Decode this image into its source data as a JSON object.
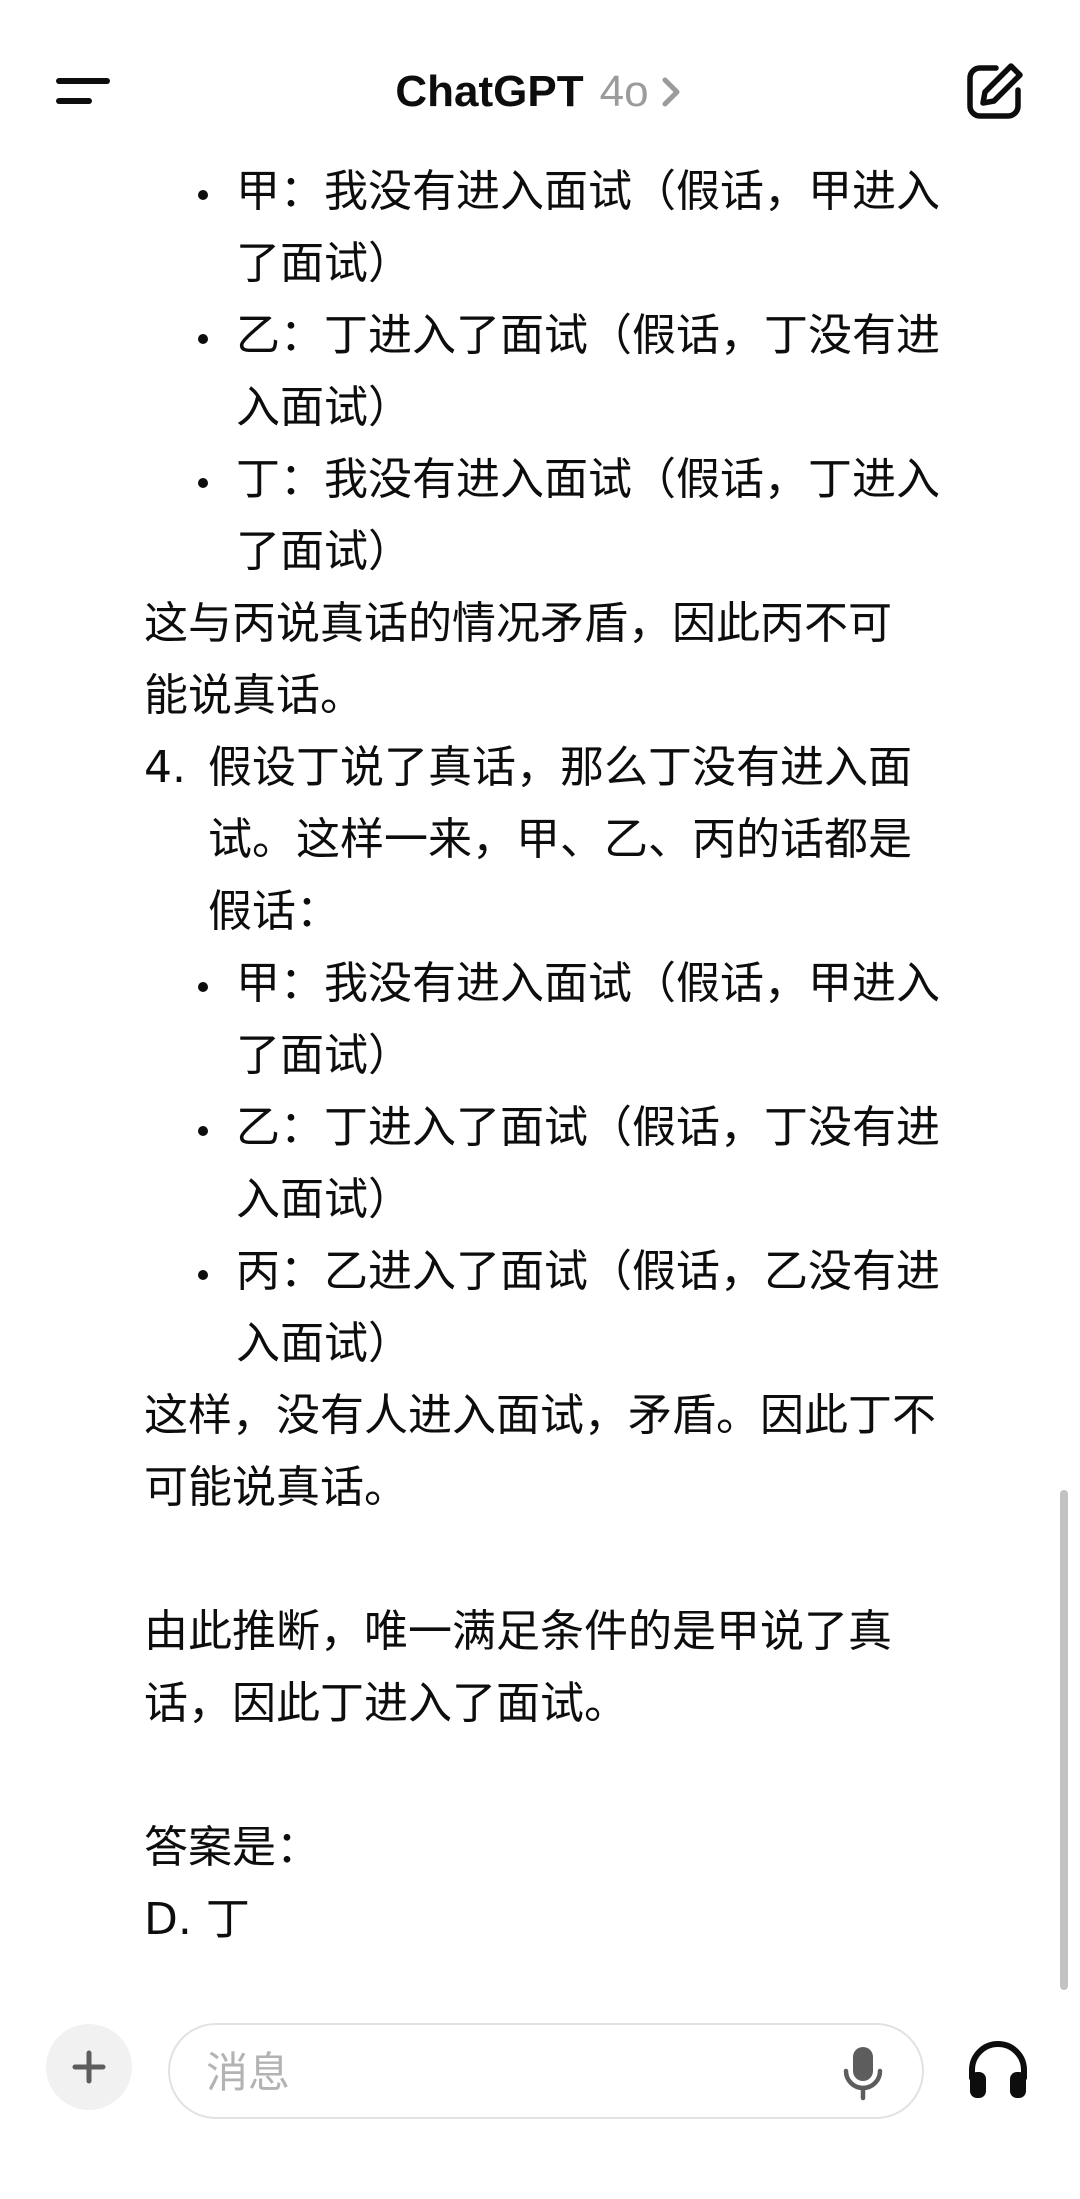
{
  "header": {
    "title": "ChatGPT",
    "model": "4o"
  },
  "message": {
    "lines": [
      "甲：我没有进入面试（假话，甲进入",
      "了面试）",
      "乙：丁进入了面试（假话，丁没有进",
      "入面试）",
      "丁：我没有进入面试（假话，丁进入",
      "了面试）",
      "这与丙说真话的情况矛盾，因此丙不可",
      "能说真话。",
      "4.",
      "假设丁说了真话，那么丁没有进入面",
      "试。这样一来，甲、乙、丙的话都是",
      "假话：",
      "甲：我没有进入面试（假话，甲进入",
      "了面试）",
      "乙：丁进入了面试（假话，丁没有进",
      "入面试）",
      "丙：乙进入了面试（假话，乙没有进",
      "入面试）",
      "这样，没有人进入面试，矛盾。因此丁不",
      "可能说真话。",
      "由此推断，唯一满足条件的是甲说了真",
      "话，因此丁进入了面试。",
      "答案是：",
      "D. 丁"
    ]
  },
  "composer": {
    "placeholder": "消息"
  },
  "colors": {
    "text": "#0d0d0d",
    "muted": "#9b9b9b",
    "placeholder": "#b3b3b3",
    "border": "#e2e2e2",
    "scrollbar": "#c2c2c2"
  },
  "icons": {
    "menu": "menu-icon",
    "chevron": "chevron-right-icon",
    "compose": "compose-icon",
    "plus": "plus-icon",
    "mic": "microphone-icon",
    "voice": "headphones-icon"
  }
}
